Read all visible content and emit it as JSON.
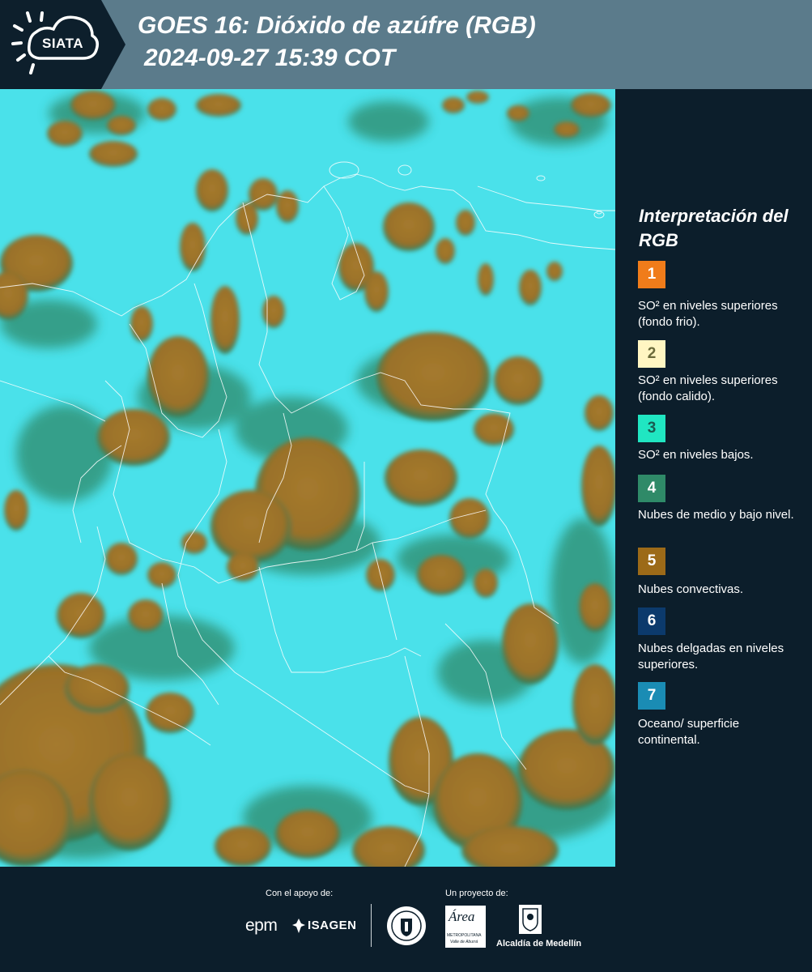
{
  "header": {
    "logo_text": "SIATA",
    "title": "GOES 16: Dióxido de azúfre (RGB)",
    "subtitle": "2024-09-27 15:39 COT",
    "background_color": "#5b7b8b"
  },
  "map": {
    "description_colors": {
      "clear_sky": "#3fdde8",
      "convective_clouds": "#a0782c",
      "mid_low_clouds": "#2f8a6a",
      "boundaries": "#ffffff"
    }
  },
  "legend": {
    "title": "Interpretación del RGB",
    "items": [
      {
        "number": "1",
        "color": "#f07c1a",
        "text_color": "#ffffff",
        "label": "SO² en niveles superiores (fondo frio)."
      },
      {
        "number": "2",
        "color": "#fff6c2",
        "text_color": "#6a6a3a",
        "label": "SO² en niveles superiores (fondo calido)."
      },
      {
        "number": "3",
        "color": "#20e6c2",
        "text_color": "#1a5a50",
        "label": "SO² en niveles bajos."
      },
      {
        "number": "4",
        "color": "#2f8a68",
        "text_color": "#ffffff",
        "label": "Nubes de medio y bajo nivel."
      },
      {
        "number": "5",
        "color": "#9c6a18",
        "text_color": "#ffffff",
        "label": "Nubes convectivas."
      },
      {
        "number": "6",
        "color": "#0c3a6c",
        "text_color": "#ffffff",
        "label": "Nubes delgadas en niveles superiores."
      },
      {
        "number": "7",
        "color": "#1a8cb4",
        "text_color": "#ffffff",
        "label": "Oceano/ superficie continental."
      }
    ]
  },
  "footer": {
    "support_label": "Con el apoyo de:",
    "project_label": "Un proyecto de:",
    "epm": "epm",
    "isagen": "ISAGEN",
    "area_word": "Área",
    "area_sub": "METROPOLITANA",
    "area_sub2": "Valle de Aburrá",
    "alcaldia": "Alcaldía de Medellín"
  }
}
